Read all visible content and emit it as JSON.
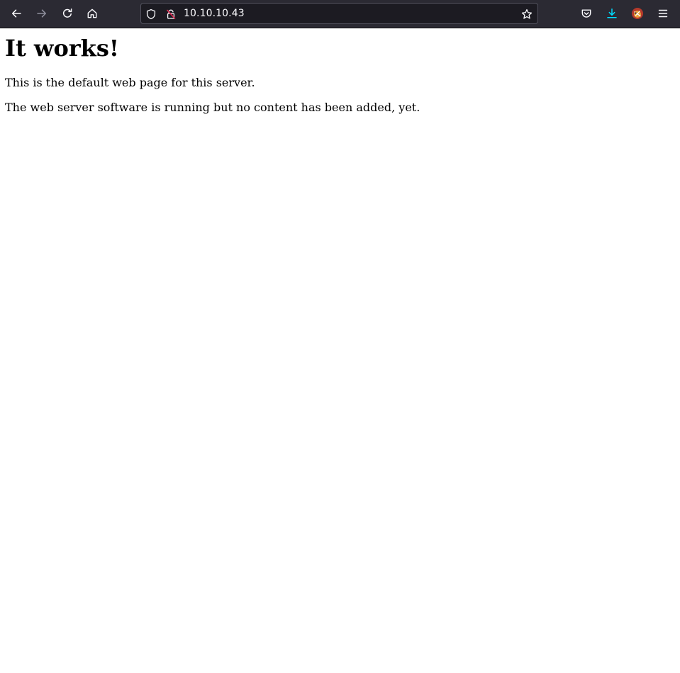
{
  "browser": {
    "address_bar": {
      "url": "10.10.10.43"
    },
    "icons": {
      "back": "arrow-left-icon",
      "forward": "arrow-right-icon",
      "reload": "reload-icon",
      "home": "home-icon",
      "tracking_protection": "shield-icon",
      "connection": "lock-icon",
      "bookmark": "star-icon",
      "pocket": "pocket-icon",
      "downloads": "download-icon",
      "extension": "extension-avatar-icon",
      "menu": "hamburger-menu-icon"
    },
    "colors": {
      "toolbar": "#2b2a33",
      "urlbar": "#1c1b22",
      "download_accent": "#00ddff",
      "lock_warning": "#e22850"
    }
  },
  "page": {
    "heading": "It works!",
    "paragraphs": [
      "This is the default web page for this server.",
      "The web server software is running but no content has been added, yet."
    ]
  }
}
